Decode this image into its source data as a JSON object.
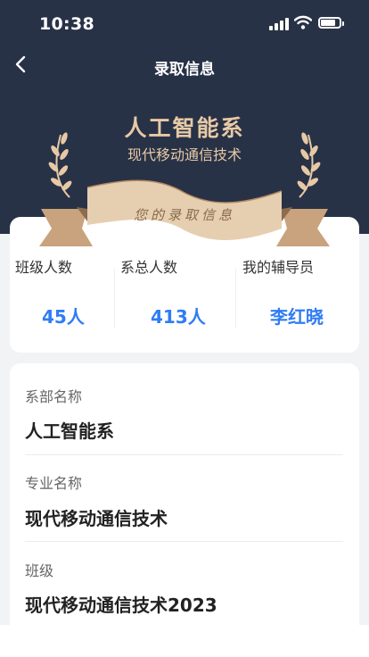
{
  "status_bar": {
    "time": "10:38"
  },
  "nav": {
    "title": "录取信息"
  },
  "hero": {
    "department": "人工智能系",
    "major": "现代移动通信技术",
    "ribbon_text": "您的录取信息"
  },
  "stats": [
    {
      "label": "班级人数",
      "value": "45人"
    },
    {
      "label": "系总人数",
      "value": "413人"
    },
    {
      "label": "我的辅导员",
      "value": "李红晓"
    }
  ],
  "details": [
    {
      "label": "系部名称",
      "value": "人工智能系"
    },
    {
      "label": "专业名称",
      "value": "现代移动通信技术"
    },
    {
      "label": "班级",
      "value": "现代移动通信技术2023"
    }
  ],
  "colors": {
    "header_bg": "#283247",
    "gold": "#e8c9a5",
    "accent_blue": "#2f7cf6"
  }
}
